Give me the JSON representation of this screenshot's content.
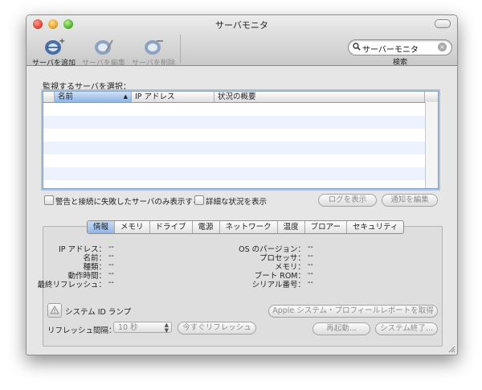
{
  "window": {
    "title": "サーバモニタ"
  },
  "toolbar": {
    "items": [
      {
        "label": "サーバを追加",
        "icon": "server-add-icon",
        "enabled": true
      },
      {
        "label": "サーバを編集",
        "icon": "server-edit-icon",
        "enabled": false
      },
      {
        "label": "サーバを削除",
        "icon": "server-delete-icon",
        "enabled": false
      }
    ],
    "search": {
      "value": "サーバーモニタ",
      "label": "検索",
      "icon": "magnifier-icon"
    }
  },
  "server_list": {
    "label": "監視するサーバを選択：",
    "columns": [
      "名前",
      "IP アドレス",
      "状況の概要"
    ],
    "sort_indicator": "▲",
    "rows": []
  },
  "options": {
    "filter_checkbox": "警告と接続に失敗したサーバのみ表示する",
    "detail_checkbox": "詳細な状況を表示",
    "show_log_button": "ログを表示",
    "edit_notify_button": "通知を編集"
  },
  "tabs": [
    "情報",
    "メモリ",
    "ドライブ",
    "電源",
    "ネットワーク",
    "温度",
    "ブロアー",
    "セキュリティ"
  ],
  "selected_tab": "情報",
  "info_left": [
    {
      "key": "IP アドレス：",
      "value": "--"
    },
    {
      "key": "名前：",
      "value": "--"
    },
    {
      "key": "種類：",
      "value": "--"
    },
    {
      "key": "動作時間：",
      "value": "--"
    },
    {
      "key": "最終リフレッシュ：",
      "value": "--"
    }
  ],
  "info_right": [
    {
      "key": "OS のバージョン：",
      "value": "--"
    },
    {
      "key": "プロセッサ：",
      "value": "--"
    },
    {
      "key": "メモリ：",
      "value": "--"
    },
    {
      "key": "ブート ROM：",
      "value": "--"
    },
    {
      "key": "シリアル番号：",
      "value": "--"
    }
  ],
  "bottom": {
    "lamp_label": "システム ID ランプ",
    "refresh_label": "リフレッシュ間隔：",
    "refresh_value": "10 秒",
    "refresh_now_button": "今すぐリフレッシュ",
    "profile_button": "Apple システム・プロフィールレポートを取得",
    "restart_button": "再起動...",
    "shutdown_button": "システム終了..."
  },
  "colors": {
    "selection": "#8fb6e8",
    "row_alt": "#edf3fe",
    "table_border": "#7f9fc7"
  }
}
